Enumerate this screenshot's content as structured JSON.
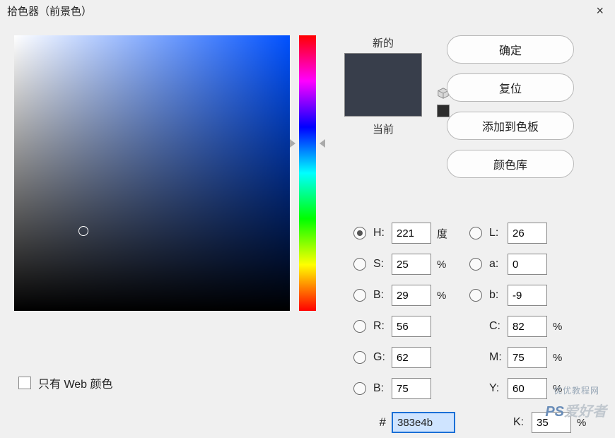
{
  "title": "拾色器（前景色）",
  "close": "×",
  "buttons": {
    "ok": "确定",
    "reset": "复位",
    "add_swatch": "添加到色板",
    "libraries": "颜色库"
  },
  "swatch": {
    "new_label": "新的",
    "current_label": "当前",
    "new_color": "#383e4b",
    "current_color": "#383e4b"
  },
  "fields": {
    "H": {
      "label": "H:",
      "value": "221",
      "unit": "度"
    },
    "S": {
      "label": "S:",
      "value": "25",
      "unit": "%"
    },
    "Bv": {
      "label": "B:",
      "value": "29",
      "unit": "%"
    },
    "R": {
      "label": "R:",
      "value": "56"
    },
    "G": {
      "label": "G:",
      "value": "62"
    },
    "Bb": {
      "label": "B:",
      "value": "75"
    },
    "L": {
      "label": "L:",
      "value": "26"
    },
    "a": {
      "label": "a:",
      "value": "0"
    },
    "b": {
      "label": "b:",
      "value": "-9"
    },
    "C": {
      "label": "C:",
      "value": "82",
      "unit": "%"
    },
    "M": {
      "label": "M:",
      "value": "75",
      "unit": "%"
    },
    "Y": {
      "label": "Y:",
      "value": "60",
      "unit": "%"
    },
    "K": {
      "label": "K:",
      "value": "35",
      "unit": "%"
    }
  },
  "hex": {
    "label": "#",
    "value": "383e4b"
  },
  "web_only": "只有 Web 颜色",
  "marker": {
    "x_pct": 25,
    "y_pct": 71
  },
  "watermark1": "优优教程网",
  "watermark2_a": "PS",
  "watermark2_b": "爱好者"
}
